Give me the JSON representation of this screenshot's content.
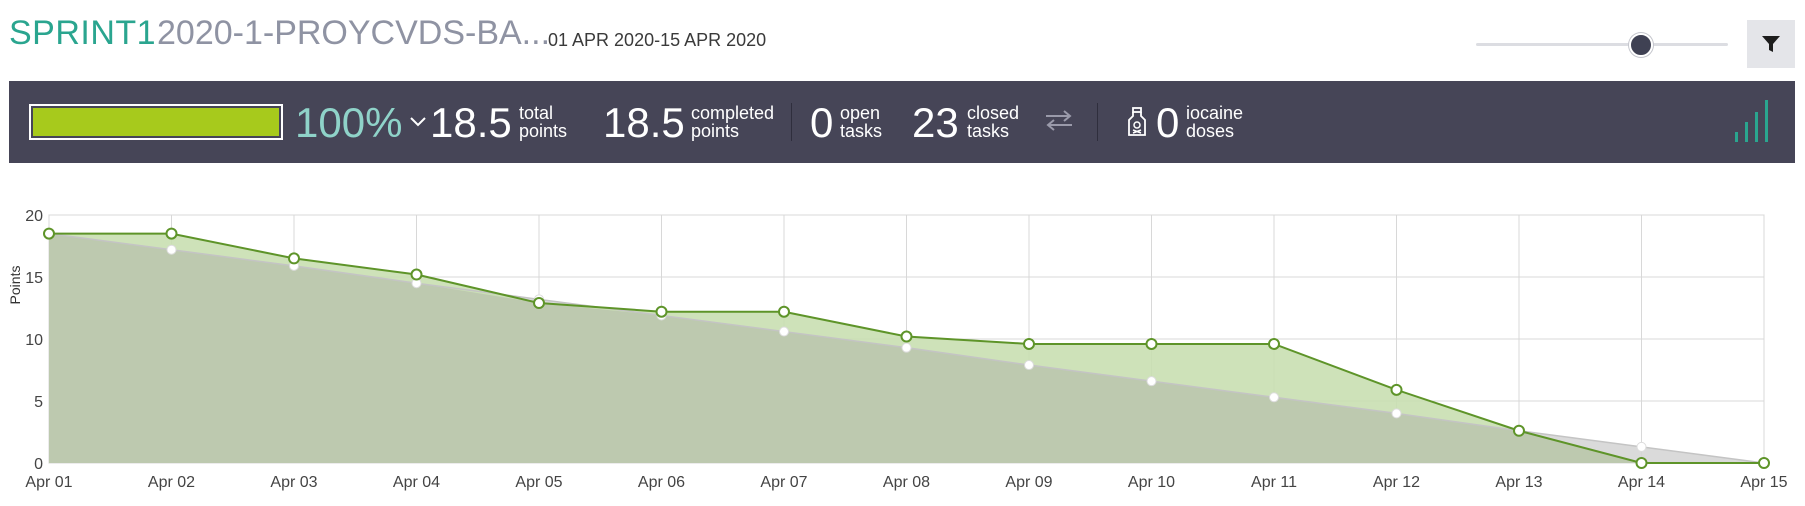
{
  "header": {
    "sprint": "SPRINT1",
    "project": "2020-1-PROYCVDS-BA...",
    "dates": "01 APR 2020-15 APR 2020",
    "zoom_level": 0.65
  },
  "stats": {
    "progress_percent": "100%",
    "progress_fraction": 1.0,
    "total_points": {
      "value": "18.5",
      "label_line1": "total",
      "label_line2": "points"
    },
    "completed_points": {
      "value": "18.5",
      "label_line1": "completed",
      "label_line2": "points"
    },
    "open_tasks": {
      "value": "0",
      "label_line1": "open",
      "label_line2": "tasks"
    },
    "closed_tasks": {
      "value": "23",
      "label_line1": "closed",
      "label_line2": "tasks"
    },
    "iocaine_doses": {
      "value": "0",
      "label_line1": "iocaine",
      "label_line2": "doses"
    }
  },
  "colors": {
    "accent": "#2aa58f",
    "progress": "#a7ca1c",
    "stats_bg": "#464557",
    "real_line": "#5e9429",
    "real_fill": "#c9dfb1",
    "ideal_fill": "#d6d6d6",
    "overlap_fill": "#bdc9af"
  },
  "icons": {
    "filter": "filter-funnel-icon",
    "chevron": "chevron-down-icon",
    "swap": "swap-arrows-icon",
    "iocaine": "poison-bottle-icon",
    "graph": "bar-graph-icon"
  },
  "chart_data": {
    "type": "area",
    "ylabel": "Points",
    "ylim": [
      0,
      20
    ],
    "yticks": [
      "0",
      "5",
      "10",
      "15",
      "20"
    ],
    "categories": [
      "Apr 01",
      "Apr 02",
      "Apr 03",
      "Apr 04",
      "Apr 05",
      "Apr 06",
      "Apr 07",
      "Apr 08",
      "Apr 09",
      "Apr 10",
      "Apr 11",
      "Apr 12",
      "Apr 13",
      "Apr 14",
      "Apr 15"
    ],
    "grid": true,
    "series": [
      {
        "values": [
          18.5,
          17.2,
          15.9,
          14.5,
          13.2,
          11.9,
          10.6,
          9.3,
          7.9,
          6.6,
          5.3,
          4.0,
          2.6,
          1.3,
          0
        ]
      },
      {
        "values": [
          18.5,
          18.5,
          16.5,
          15.2,
          12.9,
          12.2,
          12.2,
          10.2,
          9.6,
          9.6,
          9.6,
          5.9,
          2.6,
          0,
          0
        ]
      }
    ]
  }
}
